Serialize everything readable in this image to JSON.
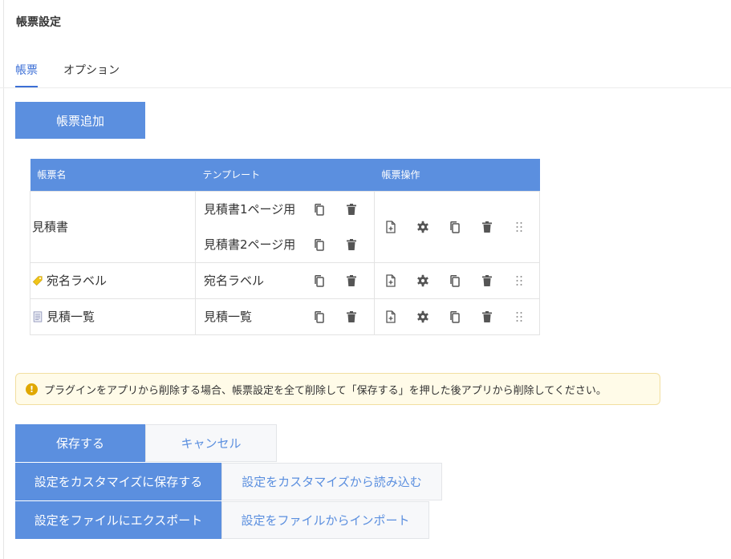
{
  "page_title": "帳票設定",
  "tabs": [
    {
      "label": "帳票",
      "active": true
    },
    {
      "label": "オプション",
      "active": false
    }
  ],
  "add_button_label": "帳票追加",
  "table": {
    "headers": [
      "帳票名",
      "テンプレート",
      "帳票操作"
    ],
    "rows": [
      {
        "name": "見積書",
        "icon": "",
        "templates": [
          "見積書1ページ用",
          "見積書2ページ用"
        ]
      },
      {
        "name": "宛名ラベル",
        "icon": "label-tag-icon",
        "templates": [
          "宛名ラベル"
        ]
      },
      {
        "name": "見積一覧",
        "icon": "document-list-icon",
        "templates": [
          "見積一覧"
        ]
      }
    ],
    "template_actions": [
      "copy-icon",
      "trash-icon"
    ],
    "form_actions": [
      "add-file-icon",
      "gear-icon",
      "copy-icon",
      "trash-icon",
      "drag-handle-icon"
    ]
  },
  "notice": {
    "icon": "warning-icon",
    "text": "プラグインをアプリから削除する場合、帳票設定を全て削除して「保存する」を押した後アプリから削除してください。"
  },
  "buttons": {
    "save": "保存する",
    "cancel": "キャンセル",
    "save_custom": "設定をカスタマイズに保存する",
    "load_custom": "設定をカスタマイズから読み込む",
    "export": "設定をファイルにエクスポート",
    "import": "設定をファイルからインポート"
  },
  "colors": {
    "accent": "#5b8fdf",
    "tab_active": "#3c6fd6",
    "icon": "#555555",
    "notice_bg": "#fffbe8",
    "notice_border": "#f2dfa0",
    "warning": "#e0a800"
  }
}
